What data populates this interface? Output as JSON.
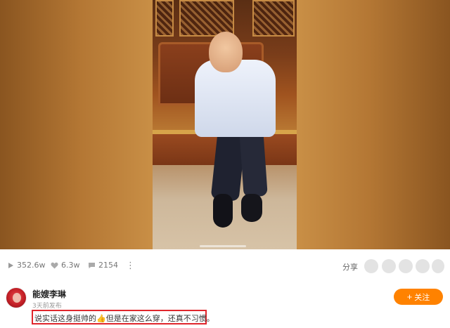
{
  "video": {
    "description_icon": "video-thumbnail"
  },
  "stats": {
    "plays": "352.6w",
    "likes": "6.3w",
    "comments": "2154",
    "more_icon": "more-vertical-icon"
  },
  "share": {
    "label": "分享",
    "targets": [
      "share-target-1",
      "share-target-2",
      "share-target-3",
      "share-target-4",
      "share-target-5"
    ]
  },
  "author": {
    "name": "能嫂李琳",
    "time": "3天前发布",
    "follow_label": "关注",
    "follow_icon": "+"
  },
  "post": {
    "text": "说实话这身挺帅的👍但是在家这么穿，还真不习惯。"
  },
  "colors": {
    "accent": "#ff8200",
    "highlight_border": "#e0262c"
  }
}
